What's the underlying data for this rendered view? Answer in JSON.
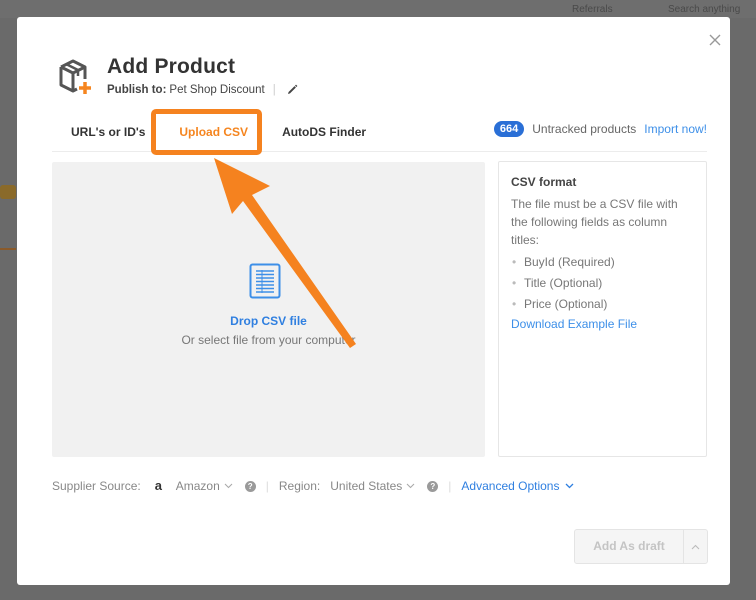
{
  "background": {
    "topbar_items": [
      "Referrals",
      "Search anything"
    ]
  },
  "modal": {
    "title": "Add Product",
    "publish_label": "Publish to:",
    "publish_value": "Pet Shop Discount",
    "publish_separator": "|",
    "tabs": [
      {
        "label": "URL's or ID's",
        "active": false
      },
      {
        "label": "Upload CSV",
        "active": true
      },
      {
        "label": "AutoDS Finder",
        "active": false
      }
    ],
    "untracked": {
      "count": "664",
      "label": "Untracked products",
      "link": "Import now!"
    },
    "dropzone": {
      "title": "Drop CSV file",
      "subtitle": "Or select file from your computer"
    },
    "csv_info": {
      "title": "CSV format",
      "description": "The file must be a CSV file with the following fields as column titles:",
      "fields": [
        "BuyId (Required)",
        "Title (Optional)",
        "Price (Optional)"
      ],
      "download_link": "Download Example File"
    },
    "options": {
      "supplier_label": "Supplier Source:",
      "supplier_value": "Amazon",
      "supplier_icon": "amazon-icon",
      "region_label": "Region:",
      "region_value": "United States",
      "help_glyph": "?",
      "separator": "|",
      "advanced_label": "Advanced Options"
    },
    "actions": {
      "primary_label": "Add As draft",
      "primary_enabled": false
    }
  },
  "annotation": {
    "color": "#f5821f",
    "target": "Upload CSV tab"
  },
  "colors": {
    "accent_orange": "#f5851f",
    "link_blue": "#2f7fe0",
    "badge_blue": "#2a6fd6"
  }
}
